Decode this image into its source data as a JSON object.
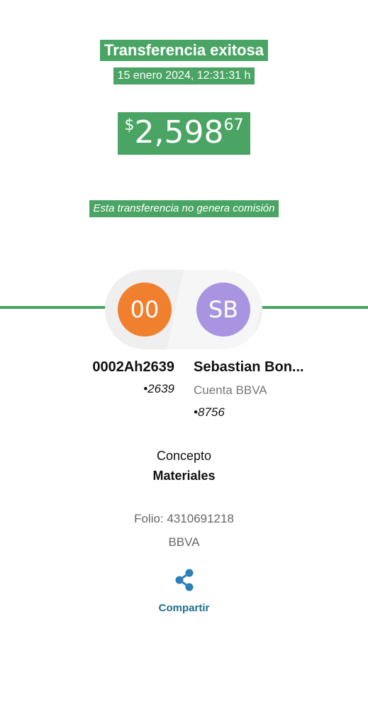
{
  "header": {
    "title": "Transferencia exitosa",
    "datetime": "15 enero 2024, 12:31:31 h",
    "amount": {
      "currency_symbol": "$",
      "integer": "2,598",
      "cents": "67"
    },
    "commission_note": "Esta transferencia no genera comisión"
  },
  "transfer": {
    "from": {
      "initials": "00",
      "name": "0002Ah2639",
      "account": "•2639",
      "color": "#f07f2e"
    },
    "to": {
      "initials": "SB",
      "name": "Sebastian Bon...",
      "bank_label": "Cuenta BBVA",
      "account": "•8756",
      "color": "#a894e0"
    }
  },
  "details": {
    "concept_label": "Concepto",
    "concept_value": "Materiales",
    "folio": "Folio: 4310691218",
    "bank": "BBVA"
  },
  "actions": {
    "share_label": "Compartir",
    "share_icon": "share-icon"
  },
  "colors": {
    "accent_green": "#4aa564",
    "share_blue": "#1f6f8b",
    "share_icon_blue": "#2d7fb8"
  }
}
